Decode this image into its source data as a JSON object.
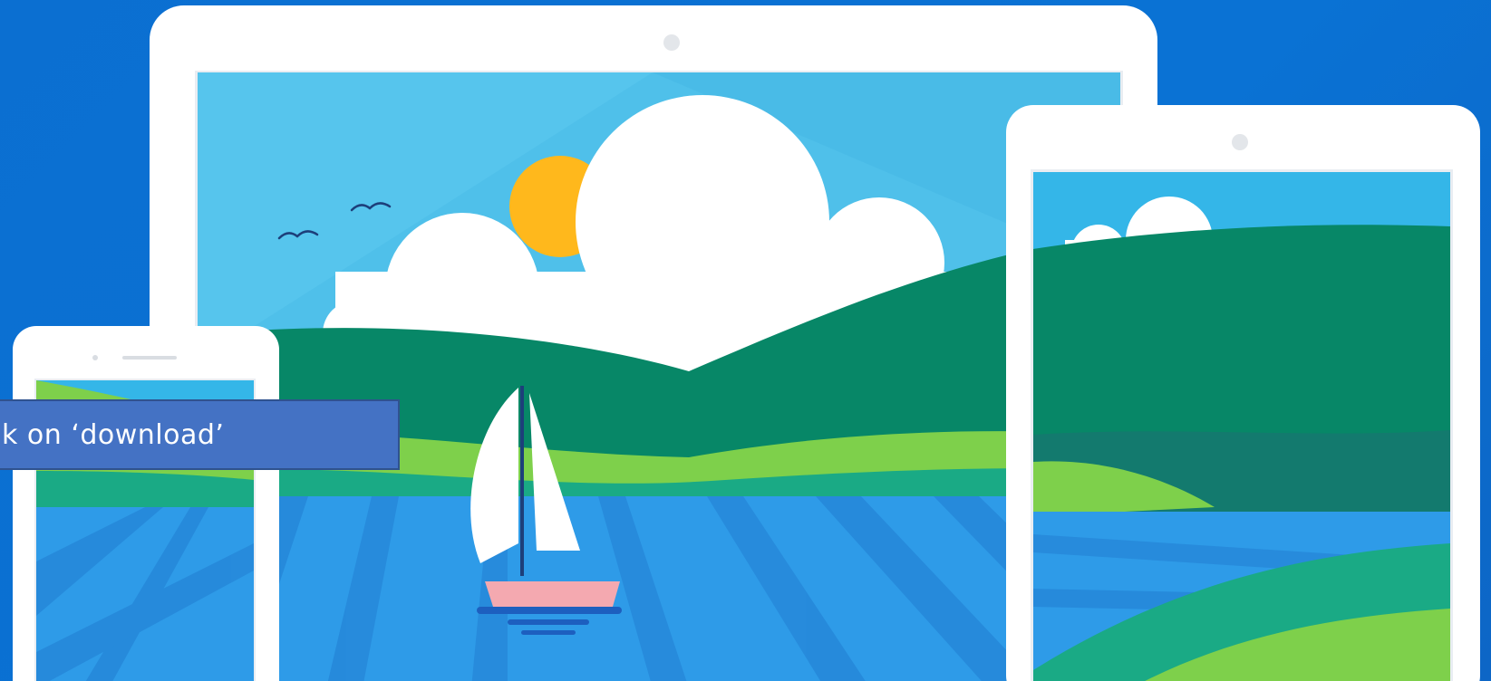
{
  "callout": {
    "text": "k on ‘download’"
  },
  "scene": {
    "description_icons": [
      "laptop-device-icon",
      "tablet-device-icon",
      "phone-device-icon",
      "sun-icon",
      "cloud-icon",
      "bird-icon",
      "sailboat-icon"
    ]
  },
  "colors": {
    "background": "#0a72d4",
    "device_frame": "#ffffff",
    "sky": "#4fc0ea",
    "sun": "#ffb81c",
    "hill_dark": "#078767",
    "hill_light": "#7ed04b",
    "water": "#2e9be8",
    "callout_fill": "#4472c4",
    "callout_border": "#2f528f"
  }
}
